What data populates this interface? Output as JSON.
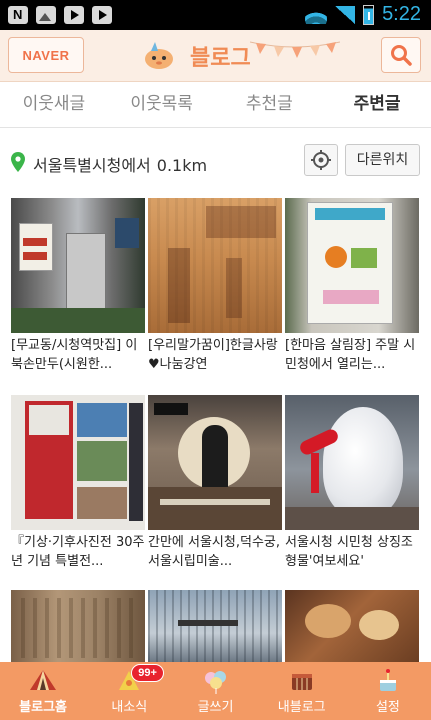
{
  "status_bar": {
    "time": "5:22",
    "left_icons": [
      "naver-notification-icon",
      "image-icon",
      "play-store-icon",
      "play-store-icon"
    ],
    "right_icons": [
      "wifi-icon",
      "signal-icon",
      "battery-icon"
    ]
  },
  "header": {
    "naver_label": "NAVER",
    "logo_text": "블로그",
    "search_icon": "search-icon"
  },
  "tabs": [
    {
      "label": "이웃새글",
      "active": false
    },
    {
      "label": "이웃목록",
      "active": false
    },
    {
      "label": "추천글",
      "active": false
    },
    {
      "label": "주변글",
      "active": true
    }
  ],
  "location": {
    "place": "서울특별시청에서",
    "distance": "0.1km",
    "gps_icon": "gps-target-icon",
    "other_location_label": "다른위치"
  },
  "posts": [
    {
      "caption": "[무교동/시청역맛집] 이북손만두(시원한..."
    },
    {
      "caption": "[우리말가꿈이]한글사랑♥나눔강연"
    },
    {
      "caption": "[한마음 살림장] 주말 시민청에서 열리는..."
    },
    {
      "caption": "『기상·기후사진전 30주년 기념 특별전..."
    },
    {
      "caption": "간만에 서울시청,덕수궁,서울시립미술..."
    },
    {
      "caption": "서울시청 시민청 상징조형물'여보세요'"
    },
    {
      "caption": ""
    },
    {
      "caption": ""
    },
    {
      "caption": ""
    }
  ],
  "bottom_nav": [
    {
      "label": "블로그홈",
      "icon": "tent-home-icon",
      "active": true
    },
    {
      "label": "내소식",
      "icon": "bell-news-icon",
      "badge": "99+"
    },
    {
      "label": "글쓰기",
      "icon": "balloons-write-icon"
    },
    {
      "label": "내블로그",
      "icon": "drum-myblog-icon"
    },
    {
      "label": "설정",
      "icon": "cake-settings-icon"
    }
  ],
  "colors": {
    "accent_orange": "#f39a64",
    "header_bg": "#fbeee4",
    "status_blue": "#33b5e5",
    "badge_red": "#e8232e"
  }
}
